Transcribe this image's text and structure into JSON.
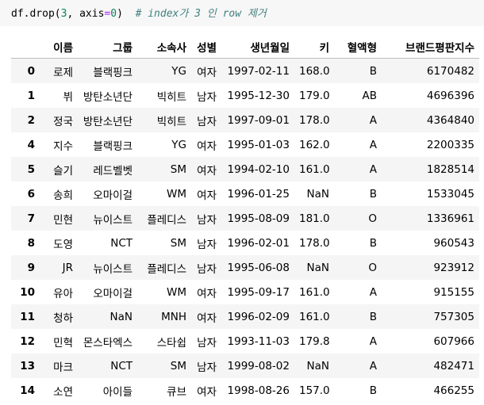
{
  "code": {
    "prefix": "df.drop(",
    "arg1": "3",
    "sep": ", axis",
    "eq": "=",
    "arg2": "0",
    "suffix": ")  ",
    "comment": "# index가 3 인 row 제거"
  },
  "table": {
    "columns": [
      "",
      "이름",
      "그룹",
      "소속사",
      "성별",
      "생년월일",
      "키",
      "혈액형",
      "브랜드평판지수"
    ],
    "rows": [
      [
        "0",
        "로제",
        "블랙핑크",
        "YG",
        "여자",
        "1997-02-11",
        "168.0",
        "B",
        "6170482"
      ],
      [
        "1",
        "뷔",
        "방탄소년단",
        "빅히트",
        "남자",
        "1995-12-30",
        "179.0",
        "AB",
        "4696396"
      ],
      [
        "2",
        "정국",
        "방탄소년단",
        "빅히트",
        "남자",
        "1997-09-01",
        "178.0",
        "A",
        "4364840"
      ],
      [
        "4",
        "지수",
        "블랙핑크",
        "YG",
        "여자",
        "1995-01-03",
        "162.0",
        "A",
        "2200335"
      ],
      [
        "5",
        "슬기",
        "레드벨벳",
        "SM",
        "여자",
        "1994-02-10",
        "161.0",
        "A",
        "1828514"
      ],
      [
        "6",
        "송희",
        "오마이걸",
        "WM",
        "여자",
        "1996-01-25",
        "NaN",
        "B",
        "1533045"
      ],
      [
        "7",
        "민현",
        "뉴이스트",
        "플레디스",
        "남자",
        "1995-08-09",
        "181.0",
        "O",
        "1336961"
      ],
      [
        "8",
        "도영",
        "NCT",
        "SM",
        "남자",
        "1996-02-01",
        "178.0",
        "B",
        "960543"
      ],
      [
        "9",
        "JR",
        "뉴이스트",
        "플레디스",
        "남자",
        "1995-06-08",
        "NaN",
        "O",
        "923912"
      ],
      [
        "10",
        "유아",
        "오마이걸",
        "WM",
        "여자",
        "1995-09-17",
        "161.0",
        "A",
        "915155"
      ],
      [
        "11",
        "청하",
        "NaN",
        "MNH",
        "여자",
        "1996-02-09",
        "161.0",
        "B",
        "757305"
      ],
      [
        "12",
        "민혁",
        "몬스타엑스",
        "스타쉽",
        "남자",
        "1993-11-03",
        "179.8",
        "A",
        "607966"
      ],
      [
        "13",
        "마크",
        "NCT",
        "SM",
        "남자",
        "1999-08-02",
        "NaN",
        "A",
        "482471"
      ],
      [
        "14",
        "소연",
        "아이들",
        "큐브",
        "여자",
        "1998-08-26",
        "157.0",
        "B",
        "466255"
      ]
    ]
  }
}
